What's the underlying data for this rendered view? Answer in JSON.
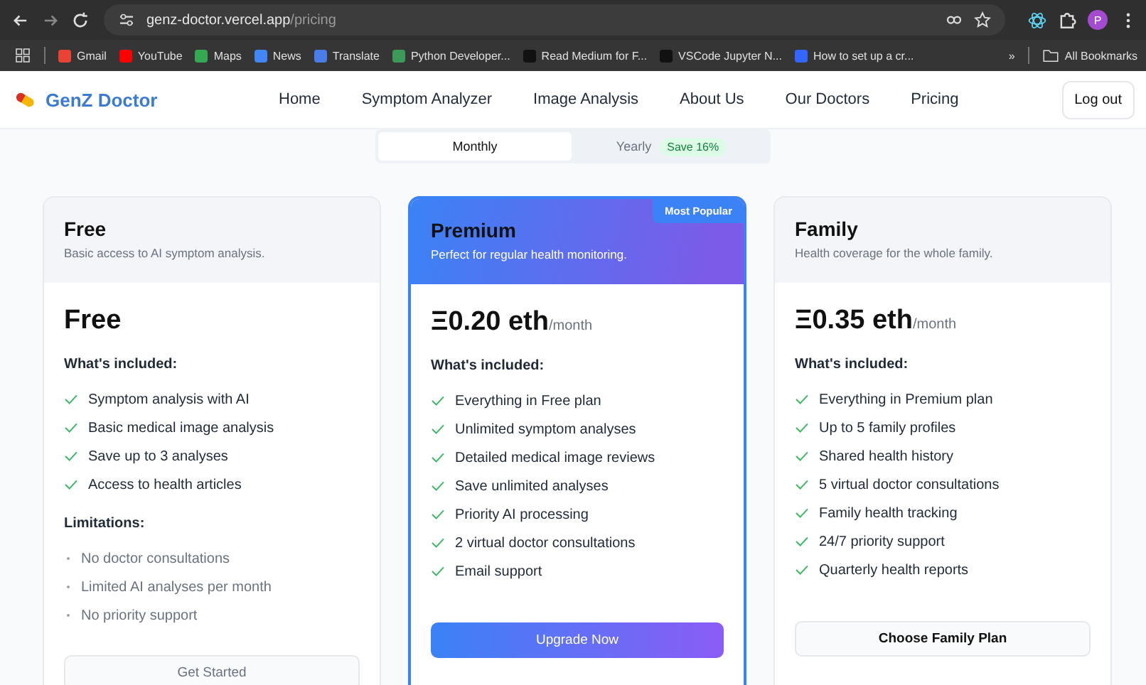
{
  "browser": {
    "url_host": "genz-doctor.vercel.app",
    "url_path": "/pricing",
    "profile_initial": "P",
    "bookmarks": [
      {
        "label": "Gmail",
        "color": "#ea4335"
      },
      {
        "label": "YouTube",
        "color": "#ff0000"
      },
      {
        "label": "Maps",
        "color": "#34a853"
      },
      {
        "label": "News",
        "color": "#4285f4"
      },
      {
        "label": "Translate",
        "color": "#4a7de8"
      },
      {
        "label": "Python Developer...",
        "color": "#3b9a5a"
      },
      {
        "label": "Read Medium for F...",
        "color": "#111111"
      },
      {
        "label": "VSCode Jupyter N...",
        "color": "#111111"
      },
      {
        "label": "How to set up a cr...",
        "color": "#3366ff"
      }
    ],
    "more": "»",
    "all_bookmarks": "All Bookmarks"
  },
  "header": {
    "brand": "GenZ Doctor",
    "nav": [
      "Home",
      "Symptom Analyzer",
      "Image Analysis",
      "About Us",
      "Our Doctors",
      "Pricing"
    ],
    "logout": "Log out"
  },
  "billing_toggle": [
    {
      "label": "Monthly",
      "selected": true
    },
    {
      "label": "Yearly",
      "selected": false,
      "badge": "Save 16%"
    }
  ],
  "plans": [
    {
      "name": "Free",
      "description": "Basic access to AI symptom analysis.",
      "price": "Free",
      "featured": false,
      "included_heading": "What's included:",
      "features": [
        "Symptom analysis with AI",
        "Basic medical image analysis",
        "Save up to 3 analyses",
        "Access to health articles"
      ],
      "limitations_heading": "Limitations:",
      "limitations": [
        "No doctor consultations",
        "Limited AI analyses per month",
        "No priority support"
      ],
      "button": "Get Started"
    },
    {
      "name": "Premium",
      "description": "Perfect for regular health monitoring.",
      "price": "Ξ0.20 eth",
      "period": "/month",
      "featured": true,
      "ribbon": "Most Popular",
      "included_heading": "What's included:",
      "features": [
        "Everything in Free plan",
        "Unlimited symptom analyses",
        "Detailed medical image reviews",
        "Save unlimited analyses",
        "Priority AI processing",
        "2 virtual doctor consultations",
        "Email support"
      ],
      "button": "Upgrade Now"
    },
    {
      "name": "Family",
      "description": "Health coverage for the whole family.",
      "price": "Ξ0.35 eth",
      "period": "/month",
      "featured": false,
      "included_heading": "What's included:",
      "features": [
        "Everything in Premium plan",
        "Up to 5 family profiles",
        "Shared health history",
        "5 virtual doctor consultations",
        "Family health tracking",
        "24/7 priority support",
        "Quarterly health reports"
      ],
      "button": "Choose Family Plan"
    }
  ]
}
